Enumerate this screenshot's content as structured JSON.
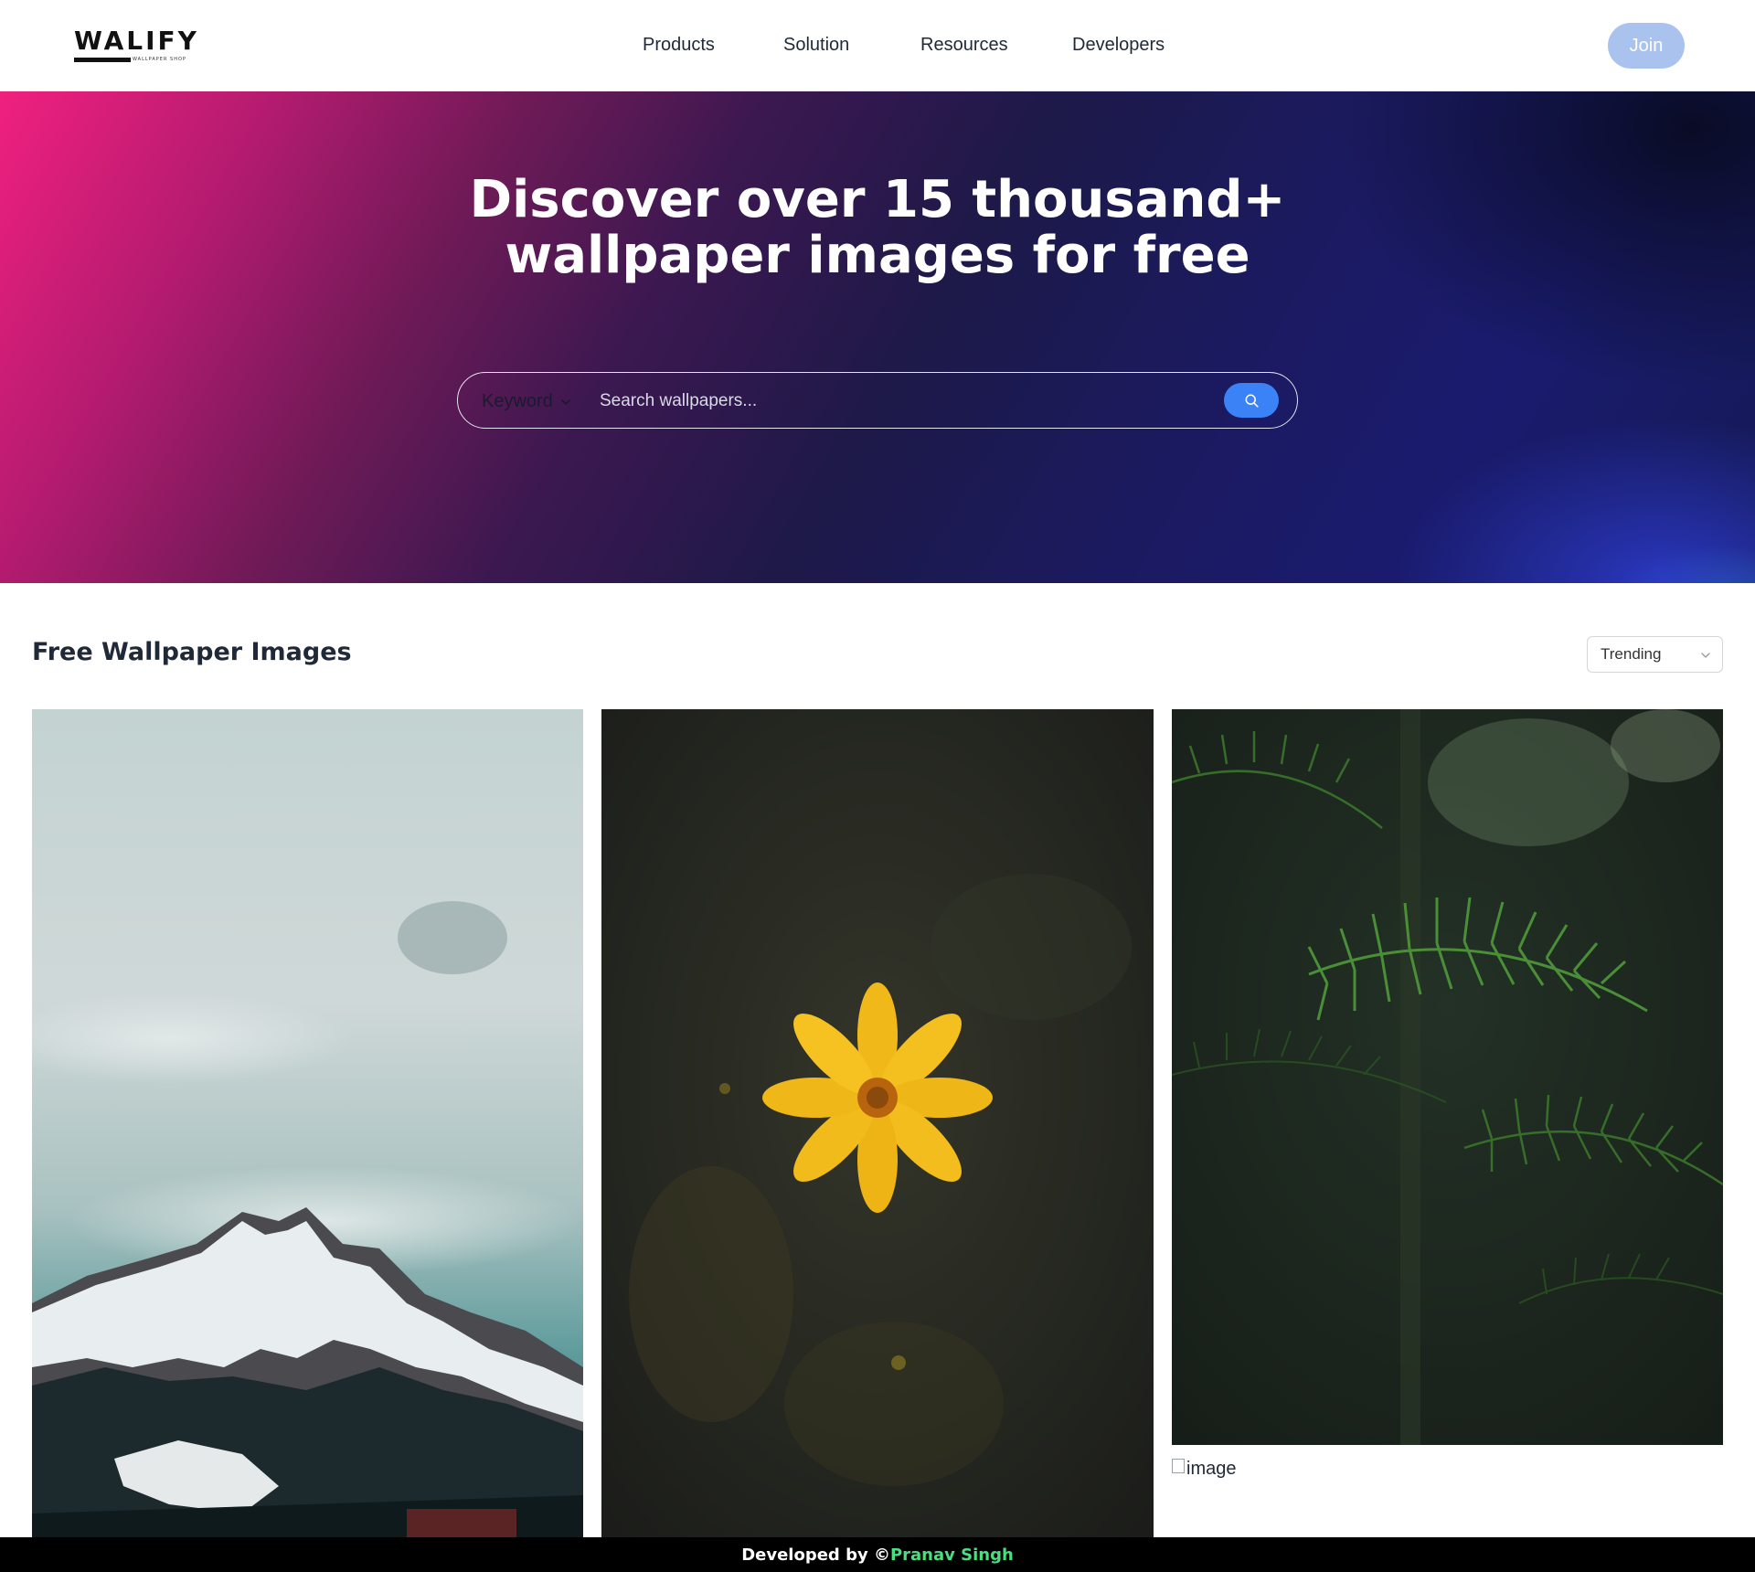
{
  "brand": {
    "logo_text": "WALIFY",
    "logo_subtext": "WALLPAPER SHOP"
  },
  "nav": {
    "items": [
      {
        "label": "Products"
      },
      {
        "label": "Solution"
      },
      {
        "label": "Resources"
      },
      {
        "label": "Developers"
      }
    ],
    "join_label": "Join"
  },
  "hero": {
    "title_line1": "Discover over 15 thousand+",
    "title_line2": "wallpaper images for free"
  },
  "search": {
    "type_label": "Keyword",
    "placeholder": "Search wallpapers..."
  },
  "gallery": {
    "title": "Free Wallpaper Images",
    "sort_value": "Trending",
    "broken_alt": "image"
  },
  "footer": {
    "prefix": "Developed by ©",
    "author": "Pranav Singh"
  },
  "colors": {
    "accent": "#3b82f6",
    "join_bg": "#a9c3ee",
    "footer_bg": "#000000",
    "author": "#4ade80"
  },
  "icons": {
    "search": "search-icon",
    "dropdown": "chevron-down-icon"
  }
}
